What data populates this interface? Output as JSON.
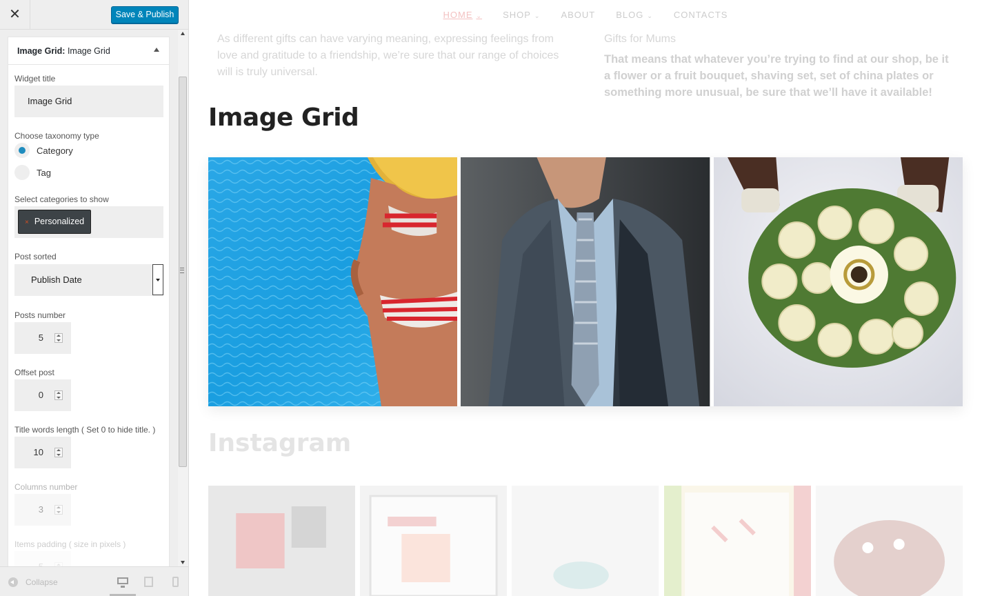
{
  "sidebar": {
    "save_label": "Save & Publish",
    "close_glyph": "✕",
    "widget": {
      "title_bold": "Image Grid:",
      "title_rest": "Image Grid"
    },
    "fields": {
      "widget_title_label": "Widget title",
      "widget_title_value": "Image Grid",
      "taxonomy_label": "Choose taxonomy type",
      "taxonomy_options": [
        "Category",
        "Tag"
      ],
      "taxonomy_selected": "Category",
      "categories_label": "Select categories to show",
      "categories_selected": [
        "Personalized"
      ],
      "chip_remove_glyph": "×",
      "post_sorted_label": "Post sorted",
      "post_sorted_value": "Publish Date",
      "posts_number_label": "Posts number",
      "posts_number_value": "5",
      "offset_label": "Offset post",
      "offset_value": "0",
      "title_words_label": "Title words length ( Set 0 to hide title. )",
      "title_words_value": "10",
      "columns_label": "Columns number",
      "columns_value": "3",
      "items_padding_label": "Items padding ( size in pixels )",
      "items_padding_value": "5"
    },
    "footer": {
      "collapse_label": "Collapse",
      "devices": [
        "desktop-icon",
        "tablet-icon",
        "mobile-icon"
      ]
    }
  },
  "preview": {
    "nav": [
      {
        "label": "HOME",
        "dropdown": true,
        "active": true
      },
      {
        "label": "SHOP",
        "dropdown": true
      },
      {
        "label": "ABOUT",
        "dropdown": false
      },
      {
        "label": "BLOG",
        "dropdown": true
      },
      {
        "label": "CONTACTS",
        "dropdown": false
      }
    ],
    "left_copy": "As different gifts can have varying meaning, expressing feelings from love and gratitude to a friendship, we’re sure that our range of choices will is truly universal.",
    "right_heading": "Gifts for Mums",
    "right_copy": "That means that whatever you’re trying to find at our shop, be it a flower or a fruit bouquet, shaving set, set of china plates or something more unusual, be sure that we’ll have it available!",
    "image_grid_title": "Image Grid",
    "grid_images": [
      "pool-bikini-photo",
      "business-suit-photo",
      "wedding-bouquet-photo"
    ],
    "instagram_title": "Instagram",
    "instagram_images": [
      "gift-box-photo",
      "framed-card-photo",
      "blurred-photo",
      "calendar-photo",
      "plush-toy-photo"
    ]
  },
  "colors": {
    "primary_button": "#0085ba",
    "radio_checked": "#1e8cbe",
    "nav_active": "#f3c1c1"
  }
}
